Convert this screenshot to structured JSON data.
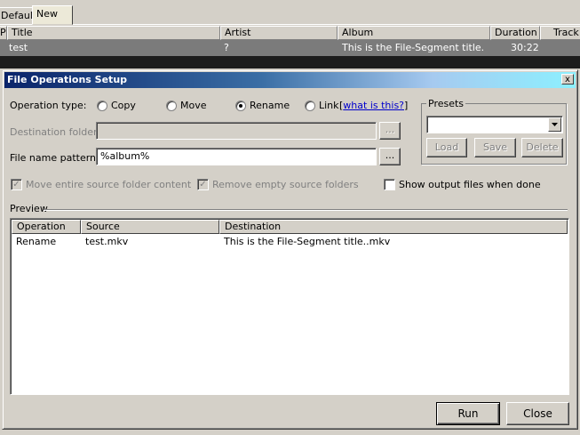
{
  "background": {
    "tabs": [
      "Default",
      "New"
    ],
    "tab_prefix": "P",
    "columns": [
      "Title",
      "Artist",
      "Album",
      "Duration",
      "Track"
    ],
    "row": {
      "title": "test",
      "artist": "?",
      "album": "This is the File-Segment title.",
      "duration": "30:22"
    }
  },
  "dialog": {
    "title": "File Operations Setup",
    "close_label": "x",
    "operation_type_label": "Operation type:",
    "operations": [
      {
        "label": "Copy",
        "selected": false
      },
      {
        "label": "Move",
        "selected": false
      },
      {
        "label": "Rename",
        "selected": true
      },
      {
        "label": "Link",
        "selected": false
      }
    ],
    "help_link": "what is this?",
    "destination_label": "Destination folder:",
    "destination_value": "",
    "pattern_label": "File name pattern:",
    "pattern_value": "%album%",
    "browse_label": "...",
    "presets": {
      "label": "Presets",
      "selected": "",
      "load": "Load",
      "save": "Save",
      "delete": "Delete"
    },
    "options": {
      "move_entire": "Move entire source folder content",
      "remove_empty": "Remove empty source folders",
      "show_output": "Show output files when done",
      "move_entire_checked": true,
      "remove_empty_checked": true,
      "show_output_checked": false
    },
    "preview": {
      "label": "Preview",
      "columns": [
        "Operation",
        "Source",
        "Destination"
      ],
      "rows": [
        {
          "operation": "Rename",
          "source": "test.mkv",
          "destination": "This is the File-Segment title..mkv"
        }
      ]
    },
    "run_label": "Run",
    "close_button_label": "Close"
  }
}
